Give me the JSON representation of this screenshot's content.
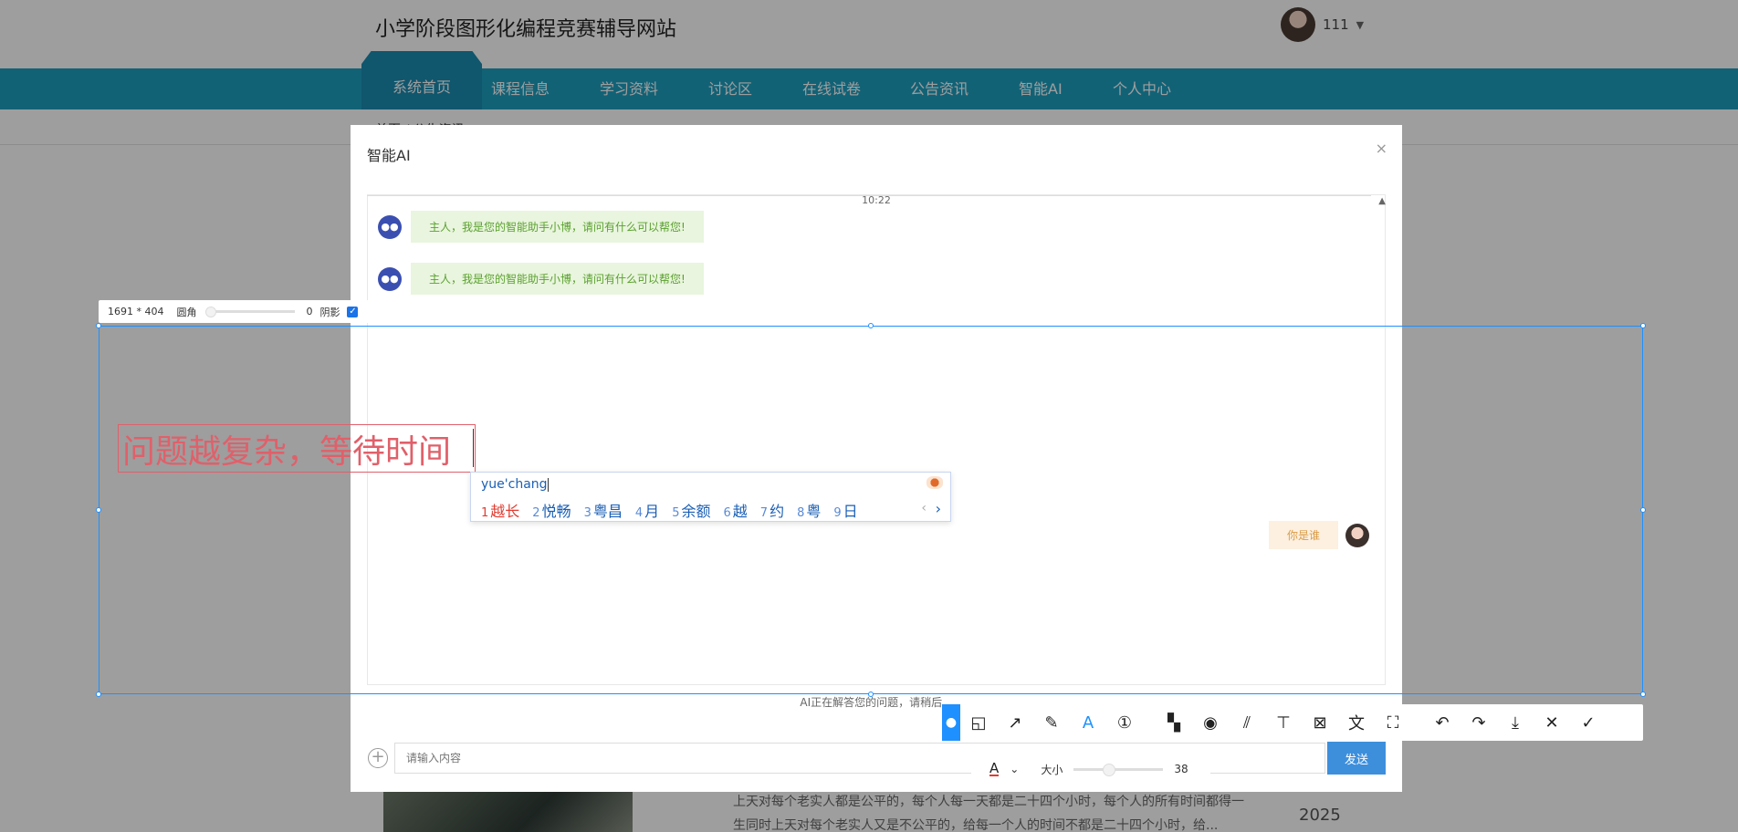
{
  "site": {
    "title": "小学阶段图形化编程竞赛辅导网站",
    "user_name": "111",
    "nav": [
      "系统首页",
      "课程信息",
      "学习资料",
      "讨论区",
      "在线试卷",
      "公告资讯",
      "智能AI",
      "个人中心"
    ],
    "breadcrumb": "首页 / 公告资讯",
    "news_text": "上天对每个老实人都是公平的，每个人每一天都是二十四个小时，每个人的所有时间都得一生同时上天对每个老实人又是不公平的，给每一个人的时间不都是二十四个小时，给...",
    "news_year": "2025"
  },
  "modal": {
    "title": "智能AI",
    "close": "×",
    "time": "10:22",
    "bot_icon": "robot-icon",
    "bot_messages": [
      "主人，我是您的智能助手小博，请问有什么可以帮您!",
      "主人，我是您的智能助手小博，请问有什么可以帮您!"
    ],
    "user_message": "你是谁",
    "status": "AI正在解答您的问题，请稍后...",
    "input_placeholder": "请输入内容",
    "send_label": "发送"
  },
  "screenshot_tool": {
    "size_readout": "1691 * 404",
    "radius_label": "圆角",
    "radius_value": "0",
    "shadow_label": "阴影",
    "shadow_checked": true,
    "annotation_text": "问题越复杂，等待时间",
    "annotation_color": "#e0606a",
    "accent_color": "#1e90ff",
    "tools": [
      "shape-icon",
      "arrow-icon",
      "pen-icon",
      "text-icon",
      "number-icon",
      "mosaic-icon",
      "blur-icon",
      "stripes-icon",
      "pin-icon",
      "ocr-icon",
      "translate-icon",
      "text-recognize-icon",
      "undo-icon",
      "redo-icon",
      "download-icon",
      "close-icon",
      "confirm-icon"
    ],
    "font_size_label": "大小",
    "font_size_value": "38"
  },
  "ime": {
    "pinyin": "yue'chang",
    "candidates": [
      {
        "num": "1",
        "text": "越长"
      },
      {
        "num": "2",
        "text": "悦畅"
      },
      {
        "num": "3",
        "text": "粤昌"
      },
      {
        "num": "4",
        "text": "月"
      },
      {
        "num": "5",
        "text": "余额"
      },
      {
        "num": "6",
        "text": "越"
      },
      {
        "num": "7",
        "text": "约"
      },
      {
        "num": "8",
        "text": "粤"
      },
      {
        "num": "9",
        "text": "日"
      }
    ]
  }
}
